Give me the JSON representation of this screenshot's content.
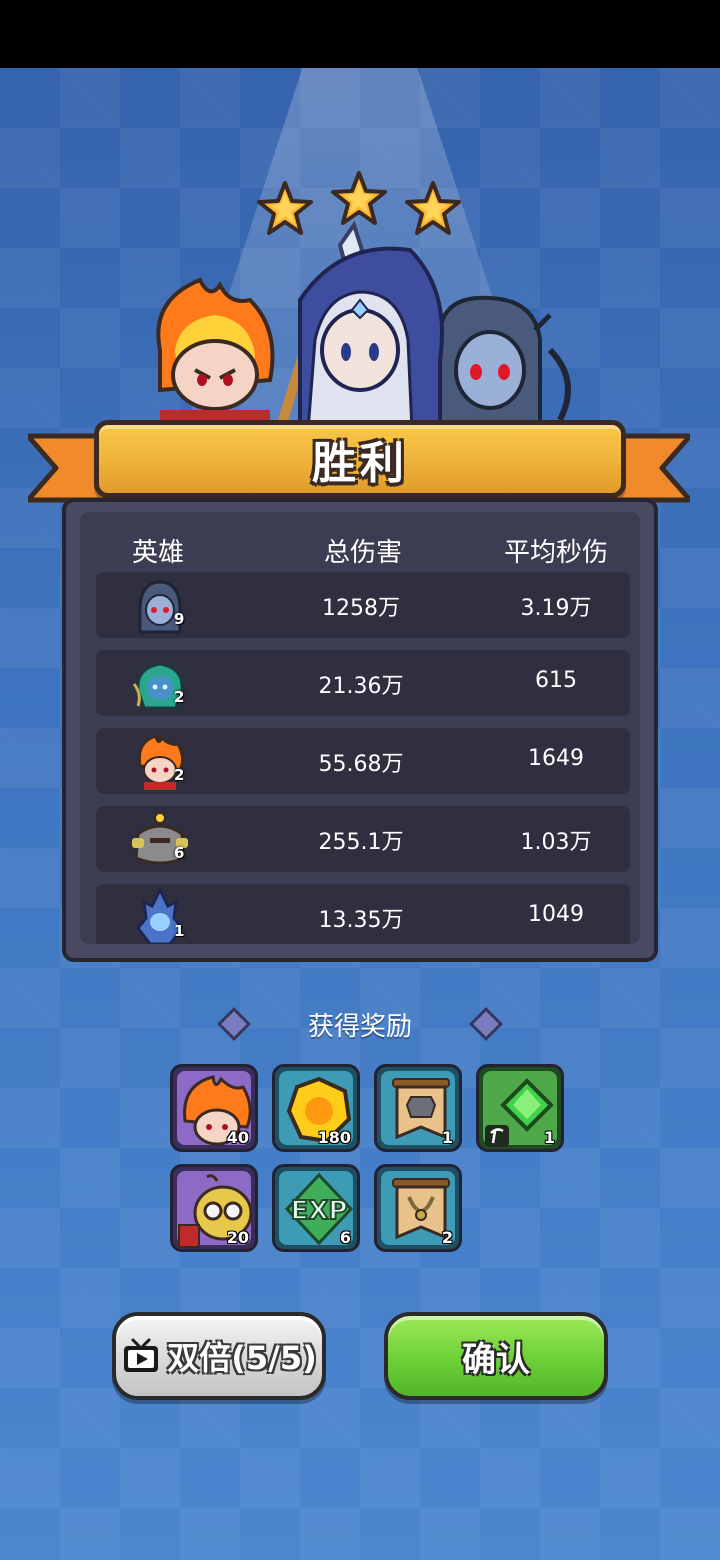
{
  "result": {
    "title": "胜利",
    "stars": 3
  },
  "stats": {
    "headers": {
      "hero": "英雄",
      "total_damage": "总伤害",
      "avg_dps": "平均秒伤"
    },
    "rows": [
      {
        "hero_icon": "dark-elf-archer-icon",
        "level": "9",
        "damage": "1258万",
        "dps": "3.19万"
      },
      {
        "hero_icon": "naga-hero-icon",
        "level": "2",
        "damage": "21.36万",
        "dps": "615"
      },
      {
        "hero_icon": "fire-monkey-hero-icon",
        "level": "2",
        "damage": "55.68万",
        "dps": "1649"
      },
      {
        "hero_icon": "stone-golem-hero-icon",
        "level": "6",
        "damage": "255.1万",
        "dps": "1.03万"
      },
      {
        "hero_icon": "ice-knight-hero-icon",
        "level": "1",
        "damage": "13.35万",
        "dps": "1049"
      }
    ]
  },
  "rewards": {
    "title": "获得奖励",
    "items": [
      {
        "icon": "fire-monkey-shard-icon",
        "count": "40"
      },
      {
        "icon": "gold-coin-icon",
        "count": "180"
      },
      {
        "icon": "armor-scroll-icon",
        "count": "1"
      },
      {
        "icon": "green-gem-icon",
        "count": "1"
      },
      {
        "icon": "goblin-shard-icon",
        "count": "20"
      },
      {
        "icon": "exp-icon",
        "count": "6",
        "text": "EXP"
      },
      {
        "icon": "necklace-scroll-icon",
        "count": "2"
      }
    ]
  },
  "buttons": {
    "double": "双倍(5/5)",
    "confirm": "确认"
  }
}
